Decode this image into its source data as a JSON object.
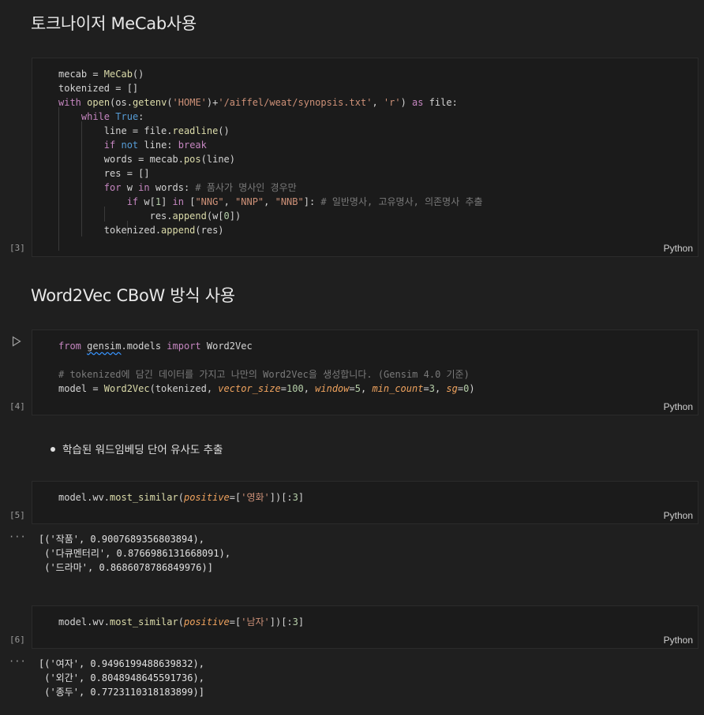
{
  "headings": {
    "h1": "토크나이저 MeCab사용",
    "h2": "Word2Vec CBoW 방식 사용"
  },
  "bullet": "학습된 워드임베딩 단어 유사도 추출",
  "cells": [
    {
      "exec": "[3]",
      "lang": "Python",
      "code": [
        "mecab = MeCab()",
        "tokenized = []",
        "with open(os.getenv('HOME')+'/aiffel/weat/synopsis.txt', 'r') as file:",
        "    while True:",
        "        line = file.readline()",
        "        if not line: break",
        "        words = mecab.pos(line)",
        "        res = []",
        "        for w in words: # 품사가 명사인 경우만",
        "            if w[1] in [\"NNG\", \"NNP\", \"NNB\"]: # 일반명사, 고유명사, 의존명사 추출",
        "                res.append(w[0])",
        "        tokenized.append(res)"
      ]
    },
    {
      "exec": "[4]",
      "lang": "Python",
      "code": [
        "from gensim.models import Word2Vec",
        "",
        "# tokenized에 담긴 데이터를 가지고 나만의 Word2Vec을 생성합니다. (Gensim 4.0 기준)",
        "model = Word2Vec(tokenized, vector_size=100, window=5, min_count=3, sg=0)"
      ]
    },
    {
      "exec": "[5]",
      "lang": "Python",
      "code": [
        "model.wv.most_similar(positive=['영화'])[:3]"
      ],
      "output": [
        "[('작품', 0.9007689356803894),",
        " ('다큐멘터리', 0.8766986131668091),",
        " ('드라마', 0.8686078786849976)]"
      ]
    },
    {
      "exec": "[6]",
      "lang": "Python",
      "code": [
        "model.wv.most_similar(positive=['남자'])[:3]"
      ],
      "output": [
        "[('여자', 0.9496199488639832),",
        " ('외간', 0.8048948645591736),",
        " ('종두', 0.7723110318183899)]"
      ]
    }
  ],
  "output_marker": "···",
  "icons": {
    "run": "play-triangle-icon"
  }
}
